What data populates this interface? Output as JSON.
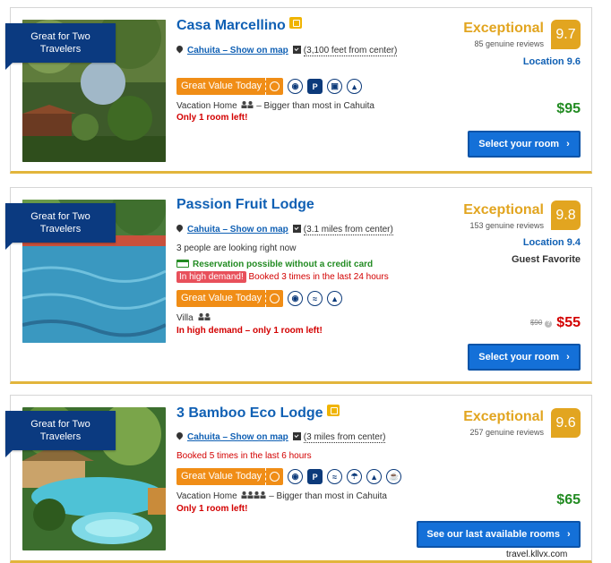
{
  "listings": [
    {
      "badge": "Great for Two Travelers",
      "name": "Casa Marcellino",
      "location_link": "Cahuita – Show on map",
      "distance": "(3,100 feet from center)",
      "deal_label": "Great Value Today",
      "property_line": "Vacation Home",
      "property_suffix": "– Bigger than most in Cahuita",
      "urgency": "Only 1 room left!",
      "rating_word": "Exceptional",
      "reviews": "85 genuine reviews",
      "score": "9.7",
      "location_score": "Location 9.6",
      "price": "$95",
      "button": "Select your room",
      "facilities": [
        "free-wifi-icon",
        "parking-icon",
        "restaurant-icon",
        "room-service-icon"
      ]
    },
    {
      "badge": "Great for Two Travelers",
      "name": "Passion Fruit Lodge",
      "location_link": "Cahuita – Show on map",
      "distance": "(3.1 miles from center)",
      "looking": "3 people are looking right now",
      "no_card": "Reservation possible without a credit card",
      "demand_pill": "In high demand!",
      "demand_text": "Booked 3 times in the last 24 hours",
      "deal_label": "Great Value Today",
      "property_line": "Villa",
      "urgency": "In high demand – only 1 room left!",
      "rating_word": "Exceptional",
      "reviews": "153 genuine reviews",
      "score": "9.8",
      "location_score": "Location 9.4",
      "guest_favorite": "Guest Favorite",
      "old_price": "$90",
      "price": "$55",
      "button": "Select your room",
      "facilities": [
        "free-wifi-icon",
        "pool-icon",
        "room-service-icon"
      ]
    },
    {
      "badge": "Great for Two Travelers",
      "name": "3 Bamboo Eco Lodge",
      "location_link": "Cahuita – Show on map",
      "distance": "(3 miles from center)",
      "booked": "Booked 5 times in the last 6 hours",
      "deal_label": "Great Value Today",
      "property_line": "Vacation Home",
      "property_suffix": "– Bigger than most in Cahuita",
      "urgency": "Only 1 room left!",
      "rating_word": "Exceptional",
      "reviews": "257 genuine reviews",
      "score": "9.6",
      "price": "$65",
      "button": "See our last available rooms",
      "facilities": [
        "free-wifi-icon",
        "parking-icon",
        "pool-icon",
        "beach-icon",
        "room-service-icon",
        "breakfast-icon"
      ]
    }
  ],
  "watermark": "travel.kllvx.com",
  "colors": {
    "brand_blue": "#1060b4",
    "score_gold": "#e2a520",
    "deal_orange": "#f08d16",
    "price_green": "#228b22",
    "price_red": "#d30000",
    "badge_navy": "#0b3a80"
  }
}
